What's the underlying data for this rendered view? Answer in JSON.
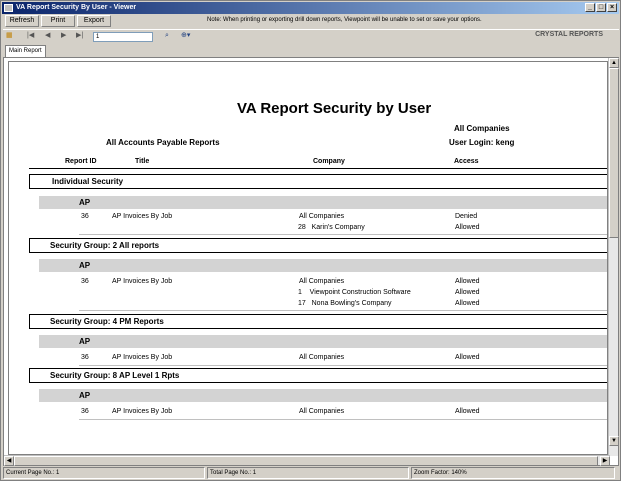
{
  "window": {
    "title": "VA Report Security By User - Viewer"
  },
  "toolbar": {
    "refresh_label": "Refresh",
    "print_label": "Print",
    "export_label": "Export",
    "note": "Note: When printing or exporting drill down reports, Viewpoint will be unable to set or save your options."
  },
  "nav": {
    "page_value": "1",
    "brand": "CRYSTAL REPORTS"
  },
  "tabs": [
    {
      "label": "Main Report"
    }
  ],
  "report": {
    "title": "VA Report Security by User",
    "subtitle_left": "All Accounts Payable Reports",
    "companies_label": "All Companies",
    "user_login": "User Login: keng",
    "columns": {
      "report_id": "Report ID",
      "title": "Title",
      "company": "Company",
      "access": "Access"
    },
    "sections": [
      {
        "header": "Individual Security",
        "module": "AP",
        "rows": [
          {
            "id": "36",
            "title": "AP Invoices By Job",
            "company": "All Companies",
            "access": "Denied"
          },
          {
            "id": "",
            "title": "",
            "company": "28   Karin's Company",
            "access": "Allowed"
          }
        ]
      },
      {
        "header": "Security Group:  2  All reports",
        "module": "AP",
        "rows": [
          {
            "id": "36",
            "title": "AP Invoices By Job",
            "company": "All Companies",
            "access": "Allowed"
          },
          {
            "id": "",
            "title": "",
            "company": "1    Viewpoint Construction Software",
            "access": "Allowed"
          },
          {
            "id": "",
            "title": "",
            "company": "17   Nona Bowling's Company",
            "access": "Allowed"
          }
        ]
      },
      {
        "header": "Security Group:  4  PM Reports",
        "module": "AP",
        "rows": [
          {
            "id": "36",
            "title": "AP Invoices By Job",
            "company": "All Companies",
            "access": "Allowed"
          }
        ]
      },
      {
        "header": "Security Group:  8  AP Level 1 Rpts",
        "module": "AP",
        "rows": [
          {
            "id": "36",
            "title": "AP Invoices By Job",
            "company": "All Companies",
            "access": "Allowed"
          }
        ]
      }
    ]
  },
  "status": {
    "current_page": "Current Page No.: 1",
    "total_page": "Total Page No.: 1",
    "zoom": "Zoom Factor: 140%"
  }
}
